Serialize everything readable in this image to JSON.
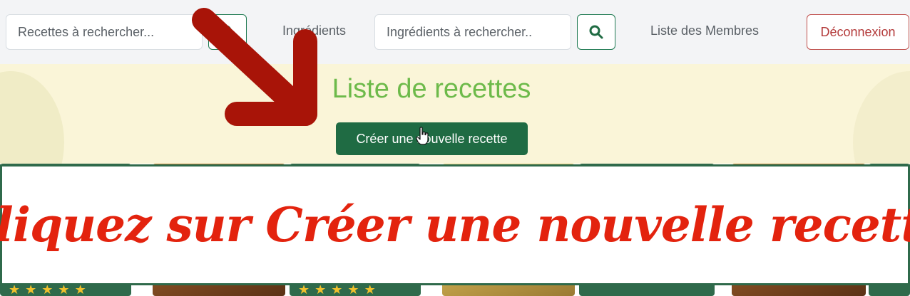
{
  "navbar": {
    "recipe_search_placeholder": "Recettes à rechercher...",
    "ingredients_link": "Ingrédients",
    "ingredient_search_placeholder": "Ingrédients à rechercher..",
    "members_link": "Liste des Membres",
    "logout_label": "Déconnexion"
  },
  "main": {
    "title": "Liste de recettes",
    "create_button": "Créer une nouvelle recette"
  },
  "banner": {
    "text": "Cliquez sur Créer une nouvelle recette"
  },
  "colors": {
    "primary_green": "#1f6b43",
    "title_green": "#6dba4a",
    "logout_red": "#b33a3a",
    "banner_red": "#e3230e",
    "arrow_red": "#a81408",
    "star_yellow": "#f1c12d"
  },
  "icons": {
    "search_button": "search-icon",
    "cursor": "hand-pointer-icon",
    "rating": "star-icon",
    "annotation": "arrow-icon"
  }
}
